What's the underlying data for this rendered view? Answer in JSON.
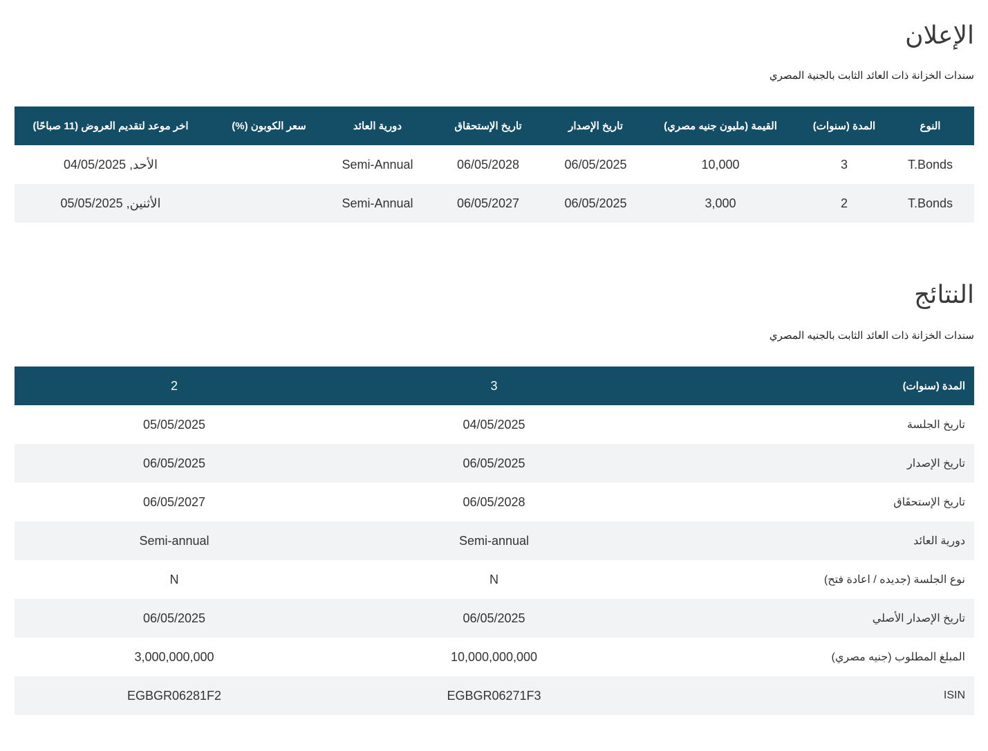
{
  "announcement": {
    "title": "الإعلان",
    "subtitle": "سندات الخزانة ذات العائد الثابت بالجنية المصري",
    "headers": [
      "النوع",
      "المدة (سنوات)",
      "القيمة (مليون جنيه مصري)",
      "تاريخ الإصدار",
      "تاريخ الإستحقاق",
      "دورية العائد",
      "سعر الكوبون (%)",
      "اخر موعد لتقديم العروض (11 صباحًا)"
    ],
    "rows": [
      {
        "type": "T.Bonds",
        "tenor": "3",
        "amount": "10,000",
        "issue_date": "06/05/2025",
        "maturity_date": "06/05/2028",
        "frequency": "Semi-Annual",
        "coupon": "",
        "deadline": "الأحد, 04/05/2025"
      },
      {
        "type": "T.Bonds",
        "tenor": "2",
        "amount": "3,000",
        "issue_date": "06/05/2025",
        "maturity_date": "06/05/2027",
        "frequency": "Semi-Annual",
        "coupon": "",
        "deadline": "الأثنين, 05/05/2025"
      }
    ]
  },
  "results": {
    "title": "النتائج",
    "subtitle": "سندات الخزانة ذات العائد الثابت بالجنيه المصري",
    "header": {
      "label": "المدة (سنوات)",
      "col_a": "3",
      "col_b": "2"
    },
    "rows": [
      {
        "label": "تاريخ الجلسة",
        "a": "04/05/2025",
        "b": "05/05/2025"
      },
      {
        "label": "تاريخ الإصدار",
        "a": "06/05/2025",
        "b": "06/05/2025"
      },
      {
        "label": "تاريخ الإستحقَاق",
        "a": "06/05/2028",
        "b": "06/05/2027"
      },
      {
        "label": "دورية العائد",
        "a": "Semi-annual",
        "b": "Semi-annual"
      },
      {
        "label": "نوع الجلسة (جديده / اعادة فتح)",
        "a": "N",
        "b": "N"
      },
      {
        "label": "تاريخ الإصدار الأصلي",
        "a": "06/05/2025",
        "b": "06/05/2025"
      },
      {
        "label": "المبلغ المطلوب (جنيه مصري)",
        "a": "10,000,000,000",
        "b": "3,000,000,000"
      },
      {
        "label": "ISIN",
        "a": "EGBGR06271F3",
        "b": "EGBGR06281F2"
      }
    ]
  },
  "colors": {
    "header_bg": "#144d66",
    "stripe_bg": "#f2f3f5"
  }
}
